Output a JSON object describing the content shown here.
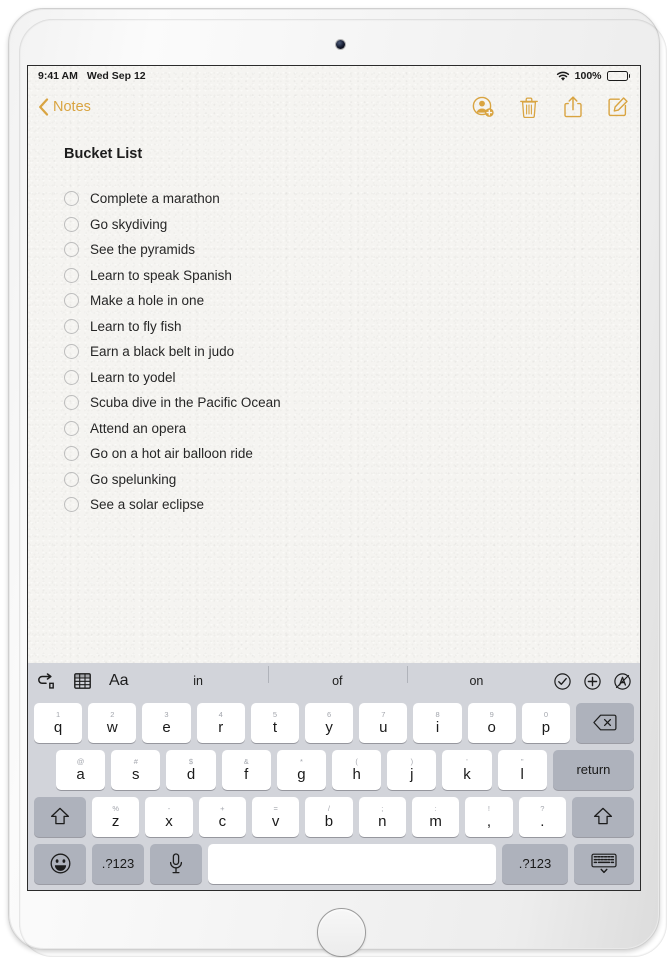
{
  "status_bar": {
    "time": "9:41 AM",
    "date": "Wed Sep 12",
    "wifi_icon": "wifi-icon",
    "battery_percent": "100%",
    "battery_icon": "battery-full-icon"
  },
  "nav_bar": {
    "back_label": "Notes",
    "back_icon": "chevron-left-icon",
    "actions": [
      {
        "name": "add-people-icon",
        "title": "Add People"
      },
      {
        "name": "trash-icon",
        "title": "Delete"
      },
      {
        "name": "share-icon",
        "title": "Share"
      },
      {
        "name": "compose-icon",
        "title": "New Note"
      }
    ]
  },
  "note": {
    "title": "Bucket List",
    "items": [
      "Complete a marathon",
      "Go skydiving",
      "See the pyramids",
      "Learn to speak Spanish",
      "Make a hole in one",
      "Learn to fly fish",
      "Earn a black belt in judo",
      "Learn to yodel",
      "Scuba dive in the Pacific Ocean",
      "Attend an opera",
      "Go on a hot air balloon ride",
      "Go spelunking",
      "See a solar eclipse"
    ]
  },
  "keyboard": {
    "toolbar": {
      "left_tools": [
        {
          "name": "undo-icon",
          "label": ""
        },
        {
          "name": "table-icon",
          "label": ""
        },
        {
          "name": "text-format-icon",
          "label": "Aa"
        }
      ],
      "predictions": [
        "in",
        "of",
        "on"
      ],
      "right_tools": [
        {
          "name": "checklist-circle-icon"
        },
        {
          "name": "add-attachment-icon"
        },
        {
          "name": "markup-pen-icon"
        }
      ]
    },
    "row1": [
      {
        "main": "q",
        "sec": "1"
      },
      {
        "main": "w",
        "sec": "2"
      },
      {
        "main": "e",
        "sec": "3"
      },
      {
        "main": "r",
        "sec": "4"
      },
      {
        "main": "t",
        "sec": "5"
      },
      {
        "main": "y",
        "sec": "6"
      },
      {
        "main": "u",
        "sec": "7"
      },
      {
        "main": "i",
        "sec": "8"
      },
      {
        "main": "o",
        "sec": "9"
      },
      {
        "main": "p",
        "sec": "0"
      }
    ],
    "delete_key": {
      "name": "delete-key",
      "icon": "backspace-icon"
    },
    "row2": [
      {
        "main": "a",
        "sec": "@"
      },
      {
        "main": "s",
        "sec": "#"
      },
      {
        "main": "d",
        "sec": "$"
      },
      {
        "main": "f",
        "sec": "&"
      },
      {
        "main": "g",
        "sec": "*"
      },
      {
        "main": "h",
        "sec": "("
      },
      {
        "main": "j",
        "sec": ")"
      },
      {
        "main": "k",
        "sec": "'"
      },
      {
        "main": "l",
        "sec": "\""
      }
    ],
    "return_key": {
      "label": "return"
    },
    "row3": [
      {
        "main": "z",
        "sec": "%"
      },
      {
        "main": "x",
        "sec": "-"
      },
      {
        "main": "c",
        "sec": "+"
      },
      {
        "main": "v",
        "sec": "="
      },
      {
        "main": "b",
        "sec": "/"
      },
      {
        "main": "n",
        "sec": ";"
      },
      {
        "main": "m",
        "sec": ":"
      },
      {
        "main": ",",
        "sec": "!"
      },
      {
        "main": ".",
        "sec": "?"
      }
    ],
    "shift_left": {
      "name": "shift-key-left",
      "icon": "shift-arrow-icon"
    },
    "shift_right": {
      "name": "shift-key-right",
      "icon": "shift-arrow-icon"
    },
    "row4": {
      "emoji_key": {
        "name": "emoji-key",
        "icon": "smiley-icon"
      },
      "numbers_key_left": {
        "label": ".?123"
      },
      "dictation_key": {
        "name": "dictation-key",
        "icon": "microphone-icon"
      },
      "space_key": {
        "label": ""
      },
      "numbers_key_right": {
        "label": ".?123"
      },
      "dismiss_key": {
        "name": "dismiss-keyboard-key",
        "icon": "hide-keyboard-icon"
      }
    }
  },
  "colors": {
    "accent": "#d9a441",
    "keyboard_bg": "#d2d4da",
    "key_white": "#ffffff",
    "key_dark": "#aeb2bc",
    "paper": "#f5f4f1"
  }
}
